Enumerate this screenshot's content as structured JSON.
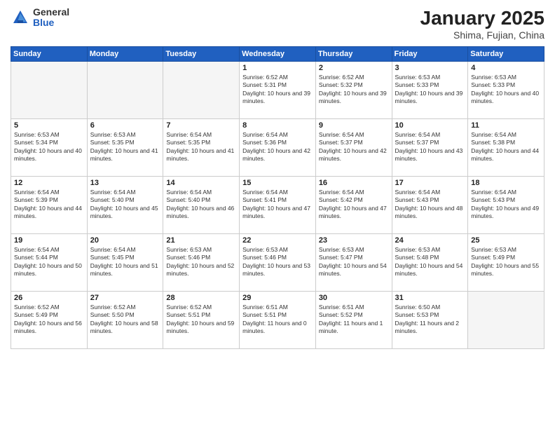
{
  "header": {
    "logo": {
      "general": "General",
      "blue": "Blue"
    },
    "title": "January 2025",
    "subtitle": "Shima, Fujian, China"
  },
  "weekdays": [
    "Sunday",
    "Monday",
    "Tuesday",
    "Wednesday",
    "Thursday",
    "Friday",
    "Saturday"
  ],
  "weeks": [
    [
      {
        "day": "",
        "empty": true
      },
      {
        "day": "",
        "empty": true
      },
      {
        "day": "",
        "empty": true
      },
      {
        "day": "1",
        "sunrise": "6:52 AM",
        "sunset": "5:31 PM",
        "daylight": "10 hours and 39 minutes."
      },
      {
        "day": "2",
        "sunrise": "6:52 AM",
        "sunset": "5:32 PM",
        "daylight": "10 hours and 39 minutes."
      },
      {
        "day": "3",
        "sunrise": "6:53 AM",
        "sunset": "5:33 PM",
        "daylight": "10 hours and 39 minutes."
      },
      {
        "day": "4",
        "sunrise": "6:53 AM",
        "sunset": "5:33 PM",
        "daylight": "10 hours and 40 minutes."
      }
    ],
    [
      {
        "day": "5",
        "sunrise": "6:53 AM",
        "sunset": "5:34 PM",
        "daylight": "10 hours and 40 minutes."
      },
      {
        "day": "6",
        "sunrise": "6:53 AM",
        "sunset": "5:35 PM",
        "daylight": "10 hours and 41 minutes."
      },
      {
        "day": "7",
        "sunrise": "6:54 AM",
        "sunset": "5:35 PM",
        "daylight": "10 hours and 41 minutes."
      },
      {
        "day": "8",
        "sunrise": "6:54 AM",
        "sunset": "5:36 PM",
        "daylight": "10 hours and 42 minutes."
      },
      {
        "day": "9",
        "sunrise": "6:54 AM",
        "sunset": "5:37 PM",
        "daylight": "10 hours and 42 minutes."
      },
      {
        "day": "10",
        "sunrise": "6:54 AM",
        "sunset": "5:37 PM",
        "daylight": "10 hours and 43 minutes."
      },
      {
        "day": "11",
        "sunrise": "6:54 AM",
        "sunset": "5:38 PM",
        "daylight": "10 hours and 44 minutes."
      }
    ],
    [
      {
        "day": "12",
        "sunrise": "6:54 AM",
        "sunset": "5:39 PM",
        "daylight": "10 hours and 44 minutes."
      },
      {
        "day": "13",
        "sunrise": "6:54 AM",
        "sunset": "5:40 PM",
        "daylight": "10 hours and 45 minutes."
      },
      {
        "day": "14",
        "sunrise": "6:54 AM",
        "sunset": "5:40 PM",
        "daylight": "10 hours and 46 minutes."
      },
      {
        "day": "15",
        "sunrise": "6:54 AM",
        "sunset": "5:41 PM",
        "daylight": "10 hours and 47 minutes."
      },
      {
        "day": "16",
        "sunrise": "6:54 AM",
        "sunset": "5:42 PM",
        "daylight": "10 hours and 47 minutes."
      },
      {
        "day": "17",
        "sunrise": "6:54 AM",
        "sunset": "5:43 PM",
        "daylight": "10 hours and 48 minutes."
      },
      {
        "day": "18",
        "sunrise": "6:54 AM",
        "sunset": "5:43 PM",
        "daylight": "10 hours and 49 minutes."
      }
    ],
    [
      {
        "day": "19",
        "sunrise": "6:54 AM",
        "sunset": "5:44 PM",
        "daylight": "10 hours and 50 minutes."
      },
      {
        "day": "20",
        "sunrise": "6:54 AM",
        "sunset": "5:45 PM",
        "daylight": "10 hours and 51 minutes."
      },
      {
        "day": "21",
        "sunrise": "6:53 AM",
        "sunset": "5:46 PM",
        "daylight": "10 hours and 52 minutes."
      },
      {
        "day": "22",
        "sunrise": "6:53 AM",
        "sunset": "5:46 PM",
        "daylight": "10 hours and 53 minutes."
      },
      {
        "day": "23",
        "sunrise": "6:53 AM",
        "sunset": "5:47 PM",
        "daylight": "10 hours and 54 minutes."
      },
      {
        "day": "24",
        "sunrise": "6:53 AM",
        "sunset": "5:48 PM",
        "daylight": "10 hours and 54 minutes."
      },
      {
        "day": "25",
        "sunrise": "6:53 AM",
        "sunset": "5:49 PM",
        "daylight": "10 hours and 55 minutes."
      }
    ],
    [
      {
        "day": "26",
        "sunrise": "6:52 AM",
        "sunset": "5:49 PM",
        "daylight": "10 hours and 56 minutes."
      },
      {
        "day": "27",
        "sunrise": "6:52 AM",
        "sunset": "5:50 PM",
        "daylight": "10 hours and 58 minutes."
      },
      {
        "day": "28",
        "sunrise": "6:52 AM",
        "sunset": "5:51 PM",
        "daylight": "10 hours and 59 minutes."
      },
      {
        "day": "29",
        "sunrise": "6:51 AM",
        "sunset": "5:51 PM",
        "daylight": "11 hours and 0 minutes."
      },
      {
        "day": "30",
        "sunrise": "6:51 AM",
        "sunset": "5:52 PM",
        "daylight": "11 hours and 1 minute."
      },
      {
        "day": "31",
        "sunrise": "6:50 AM",
        "sunset": "5:53 PM",
        "daylight": "11 hours and 2 minutes."
      },
      {
        "day": "",
        "empty": true
      }
    ]
  ]
}
